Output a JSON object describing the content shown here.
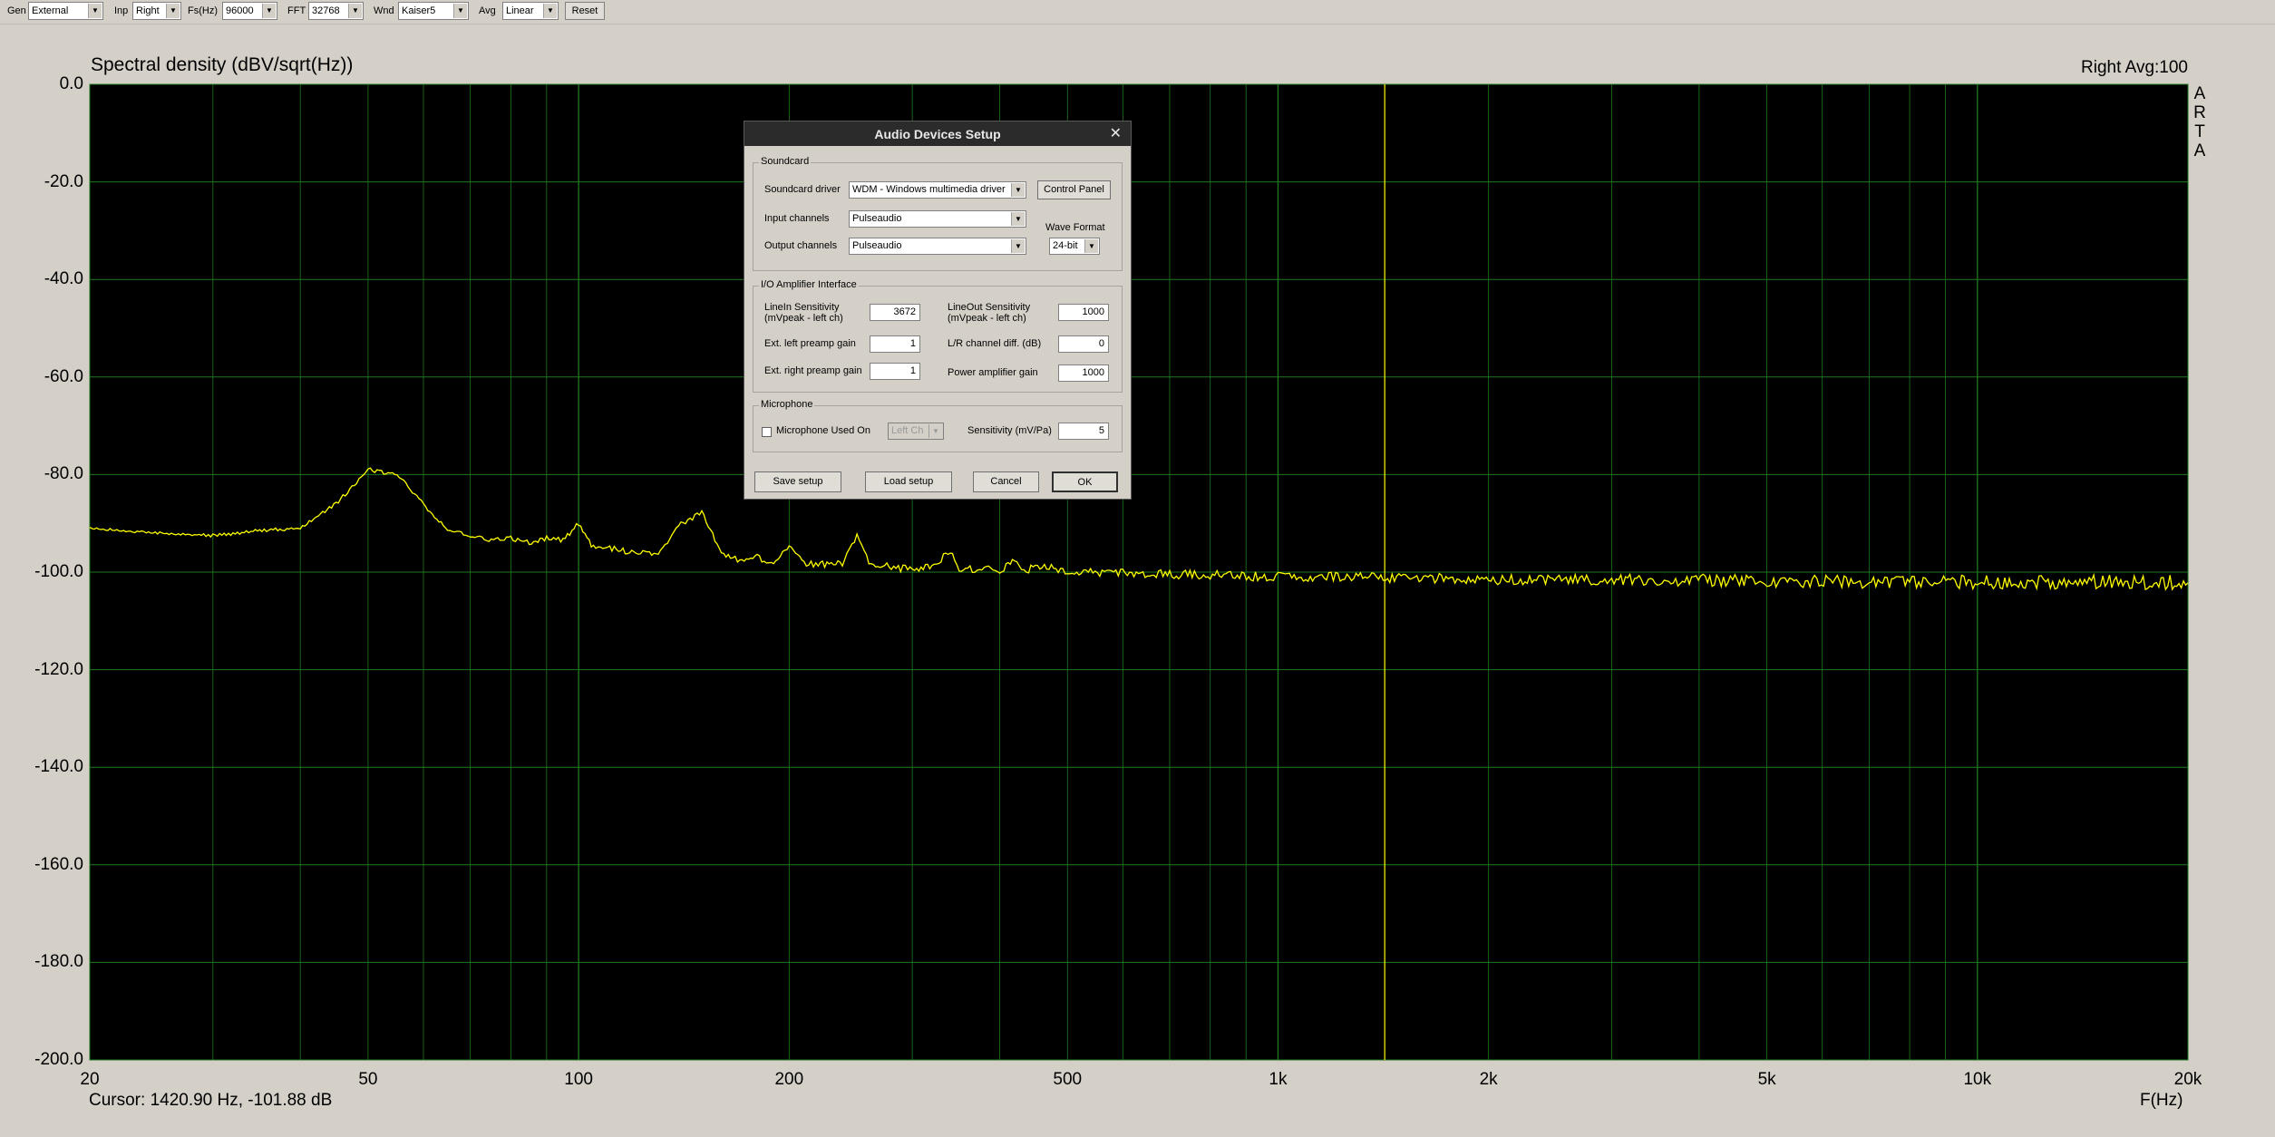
{
  "toolbar": {
    "gen": {
      "label": "Gen",
      "value": "External"
    },
    "inp": {
      "label": "Inp",
      "value": "Right"
    },
    "fs": {
      "label": "Fs(Hz)",
      "value": "96000"
    },
    "fft": {
      "label": "FFT",
      "value": "32768"
    },
    "wnd": {
      "label": "Wnd",
      "value": "Kaiser5"
    },
    "avg": {
      "label": "Avg",
      "value": "Linear"
    },
    "reset_label": "Reset"
  },
  "plot": {
    "title": "Spectral density (dBV/sqrt(Hz))",
    "status": "Right   Avg:100",
    "logo": "ARTA",
    "xlabel": "F(Hz)",
    "cursor_readout": "Cursor: 1420.90 Hz, -101.88 dB",
    "y_ticks": [
      "0.0",
      "-20.0",
      "-40.0",
      "-60.0",
      "-80.0",
      "-100.0",
      "-120.0",
      "-140.0",
      "-160.0",
      "-180.0",
      "-200.0"
    ],
    "x_ticks": [
      "20",
      "50",
      "100",
      "200",
      "500",
      "1k",
      "2k",
      "5k",
      "10k",
      "20k"
    ],
    "colors": {
      "background": "#000000",
      "grid": "#1f7a1f",
      "trace": "#ffff00",
      "cursor": "#ffff00"
    }
  },
  "chart_data": {
    "type": "line",
    "title": "Spectral density (dBV/sqrt(Hz))",
    "xlabel": "F(Hz)",
    "ylabel": "",
    "xscale": "log",
    "xlim": [
      20,
      20000
    ],
    "ylim": [
      -200,
      0
    ],
    "grid": true,
    "cursor_x": 1420.9,
    "series": [
      {
        "x": [
          20,
          25,
          30,
          35,
          40,
          45,
          50,
          55,
          60,
          65,
          70,
          75,
          80,
          85,
          90,
          95,
          100,
          105,
          110,
          120,
          130,
          140,
          150,
          160,
          170,
          180,
          190,
          200,
          210,
          220,
          240,
          250,
          260,
          280,
          300,
          320,
          340,
          350,
          360,
          380,
          400,
          420,
          440,
          460,
          500,
          600,
          700,
          800,
          1000,
          1200,
          1500,
          2000,
          3000,
          5000,
          7000,
          10000,
          15000,
          20000
        ],
        "values": [
          -91,
          -92,
          -92.5,
          -91.5,
          -91,
          -86,
          -79,
          -80,
          -86,
          -91.5,
          -92.5,
          -93.5,
          -93,
          -94,
          -93,
          -93.5,
          -90,
          -95,
          -95,
          -96,
          -96,
          -90,
          -88,
          -96,
          -97.5,
          -97,
          -98,
          -95,
          -98,
          -98.5,
          -98,
          -92,
          -98,
          -99,
          -99.5,
          -98.5,
          -96,
          -99.5,
          -99.5,
          -99,
          -99.5,
          -98,
          -99.5,
          -98.5,
          -100,
          -100,
          -100.5,
          -100.5,
          -101,
          -101,
          -101.2,
          -101.5,
          -101.5,
          -101.8,
          -102,
          -102,
          -102,
          -102.2
        ]
      }
    ]
  },
  "dialog": {
    "title": "Audio Devices Setup",
    "soundcard": {
      "group_title": "Soundcard",
      "driver_label": "Soundcard driver",
      "driver_value": "WDM - Windows multimedia driver",
      "control_panel_label": "Control Panel",
      "input_label": "Input channels",
      "input_value": "Pulseaudio",
      "output_label": "Output channels",
      "output_value": "Pulseaudio",
      "wave_format_label": "Wave Format",
      "wave_format_value": "24-bit"
    },
    "io": {
      "group_title": "I/O Amplifier Interface",
      "linein_label_1": "LineIn Sensitivity",
      "linein_label_2": "(mVpeak - left ch)",
      "linein_value": "3672",
      "lineout_label_1": "LineOut Sensitivity",
      "lineout_label_2": "(mVpeak - left ch)",
      "lineout_value": "1000",
      "left_preamp_label": "Ext. left preamp gain",
      "left_preamp_value": "1",
      "lr_diff_label": "L/R channel diff. (dB)",
      "lr_diff_value": "0",
      "right_preamp_label": "Ext. right preamp gain",
      "right_preamp_value": "1",
      "power_amp_label": "Power amplifier gain",
      "power_amp_value": "1000"
    },
    "microphone": {
      "group_title": "Microphone",
      "used_on_label": "Microphone Used On",
      "channel_value": "Left Ch",
      "sensitivity_label": "Sensitivity (mV/Pa)",
      "sensitivity_value": "5"
    },
    "buttons": {
      "save": "Save setup",
      "load": "Load setup",
      "cancel": "Cancel",
      "ok": "OK"
    }
  }
}
